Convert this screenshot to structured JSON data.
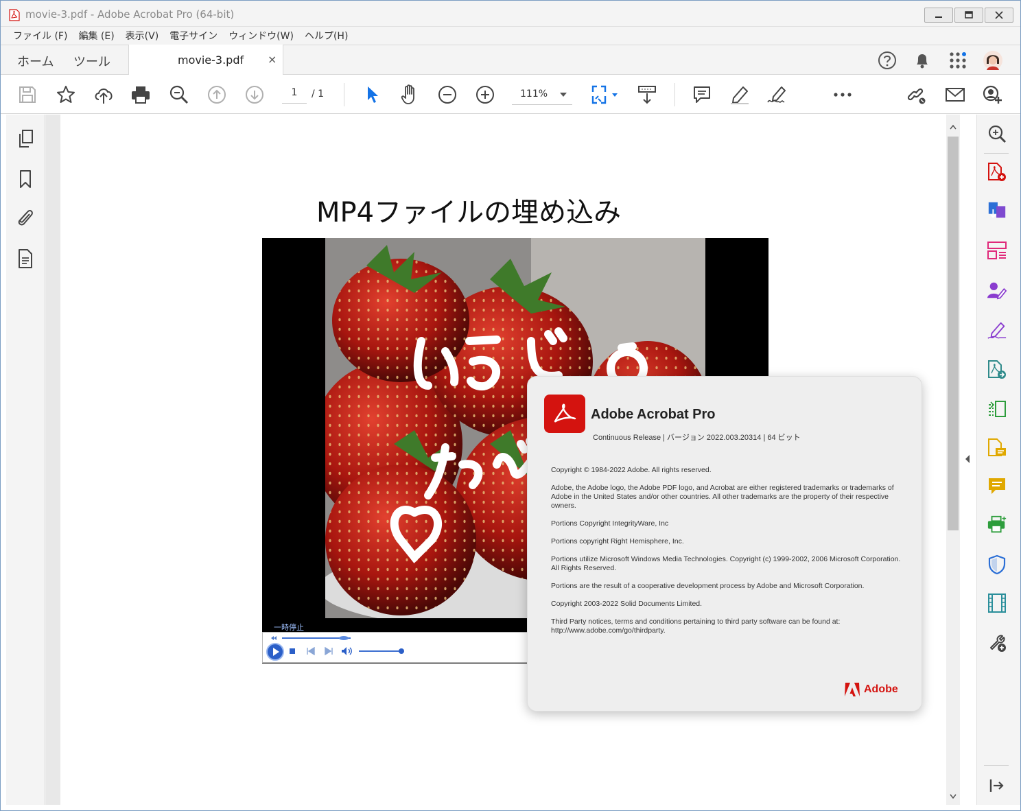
{
  "window": {
    "title": "movie-3.pdf - Adobe Acrobat Pro (64-bit)"
  },
  "menu": {
    "items": [
      "ファイル (F)",
      "編集 (E)",
      "表示(V)",
      "電子サイン",
      "ウィンドウ(W)",
      "ヘルプ(H)"
    ]
  },
  "tabs": {
    "home": "ホーム",
    "tools": "ツール",
    "document": "movie-3.pdf",
    "close": "×"
  },
  "toolbar": {
    "page_current": "1",
    "page_total": "/ 1",
    "zoom": "111%"
  },
  "document": {
    "heading": "MP4ファイルの埋め込み",
    "video": {
      "status_label": "一時停止",
      "overlay_text_1": "いちご",
      "overlay_text_2": "たべ"
    }
  },
  "about_dialog": {
    "product": "Adobe Acrobat Pro",
    "version": "Continuous Release | バージョン 2022.003.20314 | 64 ビット",
    "legal": [
      "Copyright © 1984-2022 Adobe. All rights reserved.",
      "Adobe, the Adobe logo, the Adobe PDF logo, and Acrobat are either registered trademarks or trademarks of Adobe in the United States and/or other countries. All other trademarks are the property of their respective owners.",
      "Portions Copyright IntegrityWare, Inc",
      "Portions copyright Right Hemisphere, Inc.",
      "Portions utilize Microsoft Windows Media Technologies. Copyright (c) 1999-2002, 2006 Microsoft Corporation. All Rights Reserved.",
      "Portions are the result of a cooperative development process by Adobe and Microsoft Corporation.",
      "Copyright 2003-2022 Solid Documents Limited.",
      "Third Party notices, terms and conditions pertaining to third party software can be found at: http://www.adobe.com/go/thirdparty."
    ],
    "brand": "Adobe"
  },
  "colors": {
    "acrobat_red": "#d4130f",
    "accent_blue": "#1473e6",
    "tool_pink": "#e0287a",
    "tool_purple": "#8a3ccf",
    "tool_green": "#2d9d3c",
    "tool_yellow": "#e0a800",
    "tool_blue": "#2b6fd6"
  },
  "icons": {
    "left_panel": [
      "pages-icon",
      "bookmark-icon",
      "attachment-icon",
      "document-properties-icon"
    ],
    "right_panel": [
      "search-zoom-icon",
      "create-pdf-icon",
      "combine-files-icon",
      "organize-pages-icon",
      "request-signature-icon",
      "fill-sign-icon",
      "export-pdf-icon",
      "edit-pdf-icon",
      "comment-export-icon",
      "comment-icon",
      "print-production-icon",
      "protect-icon",
      "rich-media-icon",
      "more-tools-icon",
      "collapse-pane-icon"
    ]
  }
}
